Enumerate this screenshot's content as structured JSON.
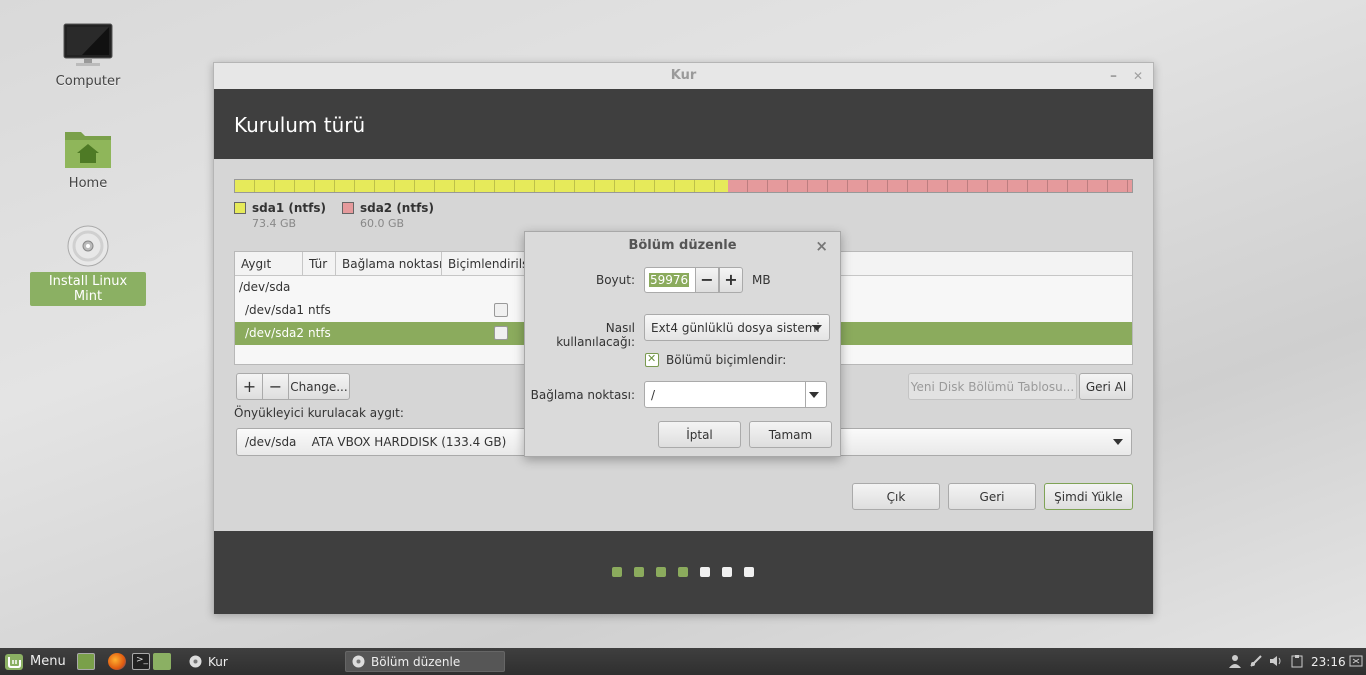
{
  "desktop": {
    "icons": [
      {
        "label": "Computer"
      },
      {
        "label": "Home"
      },
      {
        "label": "Install Linux Mint"
      }
    ]
  },
  "window": {
    "title": "Kur",
    "minimize": "–",
    "close": "✕",
    "header": "Kurulum türü",
    "partitions": [
      {
        "name": "sda1 (ntfs)",
        "size": "73.4 GB",
        "color": "#e6ea5a",
        "fraction": 0.55
      },
      {
        "name": "sda2 (ntfs)",
        "size": "60.0 GB",
        "color": "#e59a9c",
        "fraction": 0.45
      }
    ],
    "table": {
      "headers": [
        "Aygıt",
        "Tür",
        "Bağlama noktası",
        "Biçimlendirils"
      ],
      "rows": [
        {
          "device": "/dev/sda",
          "type": "",
          "checkbox": false
        },
        {
          "device": "/dev/sda1",
          "type": "ntfs",
          "checkbox": true
        },
        {
          "device": "/dev/sda2",
          "type": "ntfs",
          "checkbox": true,
          "selected": true
        }
      ]
    },
    "buttons": {
      "add": "+",
      "remove": "−",
      "change": "Change...",
      "new_table": "Yeni Disk Bölümü Tablosu...",
      "revert": "Geri Al",
      "quit": "Çık",
      "back": "Geri",
      "install": "Şimdi Yükle"
    },
    "bootloader_label": "Önyükleyici kurulacak aygıt:",
    "bootloader_value": "/dev/sda    ATA VBOX HARDDISK (133.4 GB)",
    "progress": {
      "total": 7,
      "done": 4,
      "done_color": "#8bab5d",
      "todo_color": "#f0f0f0"
    }
  },
  "dialog": {
    "title": "Bölüm düzenle",
    "close": "×",
    "size_label": "Boyut:",
    "size_value": "59976",
    "size_unit": "MB",
    "minus": "−",
    "plus": "+",
    "use_label": "Nasıl kullanılacağı:",
    "use_value": "Ext4 günlüklü dosya sistemi",
    "format_label": "Bölümü biçimlendir:",
    "format_checked": true,
    "mount_label": "Bağlama noktası:",
    "mount_value": "/",
    "cancel": "İptal",
    "ok": "Tamam"
  },
  "taskbar": {
    "menu": "Menu",
    "tasks": [
      {
        "label": "Kur"
      },
      {
        "label": "Bölüm düzenle"
      }
    ],
    "clock": "23:16"
  },
  "colors": {
    "accent": "#8bab5d",
    "header": "#3f3f3f"
  }
}
